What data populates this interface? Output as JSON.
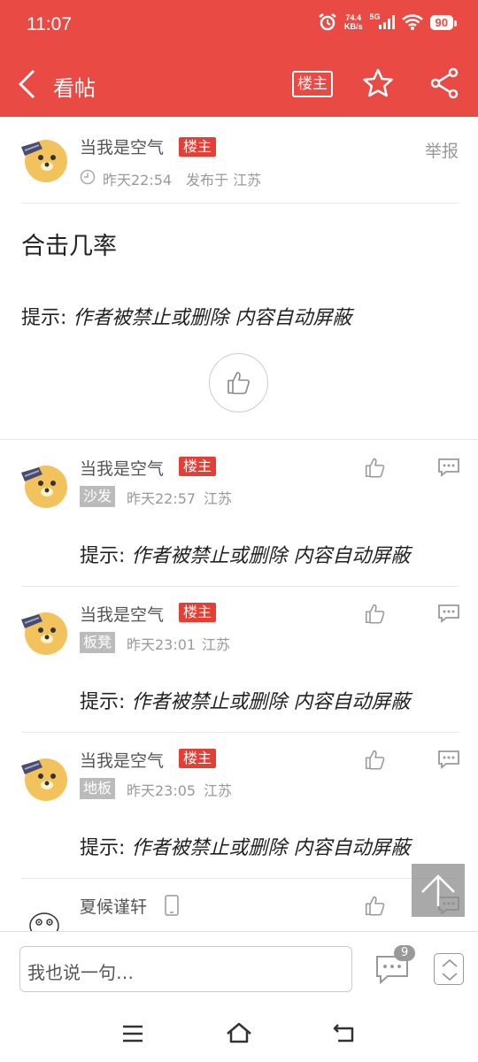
{
  "status": {
    "time": "11:07",
    "net_speed": "74.4",
    "net_unit": "KB/s",
    "signal": "5G",
    "battery": "90"
  },
  "nav": {
    "title": "看帖",
    "owner_label": "楼主"
  },
  "post": {
    "author": "当我是空气",
    "owner_tag": "楼主",
    "time": "昨天22:54",
    "location": "发布于 江苏",
    "report": "举报",
    "title": "合击几率",
    "notice_prefix": "提示:",
    "notice_text": "作者被禁止或删除 内容自动屏蔽"
  },
  "replies": [
    {
      "author": "当我是空气",
      "owner_tag": "楼主",
      "floor": "沙发",
      "time": "昨天22:57",
      "location": "江苏",
      "notice_prefix": "提示:",
      "notice_text": "作者被禁止或删除 内容自动屏蔽"
    },
    {
      "author": "当我是空气",
      "owner_tag": "楼主",
      "floor": "板凳",
      "time": "昨天23:01",
      "location": "江苏",
      "notice_prefix": "提示:",
      "notice_text": "作者被禁止或删除 内容自动屏蔽"
    },
    {
      "author": "当我是空气",
      "owner_tag": "楼主",
      "floor": "地板",
      "time": "昨天23:05",
      "location": "江苏",
      "notice_prefix": "提示:",
      "notice_text": "作者被禁止或删除 内容自动屏蔽"
    },
    {
      "author": "夏候谨轩"
    }
  ],
  "bottom": {
    "input_placeholder": "我也说一句…",
    "comment_count": "9"
  },
  "colors": {
    "brand": "#e94a43",
    "owner_tag": "#e53e35"
  }
}
